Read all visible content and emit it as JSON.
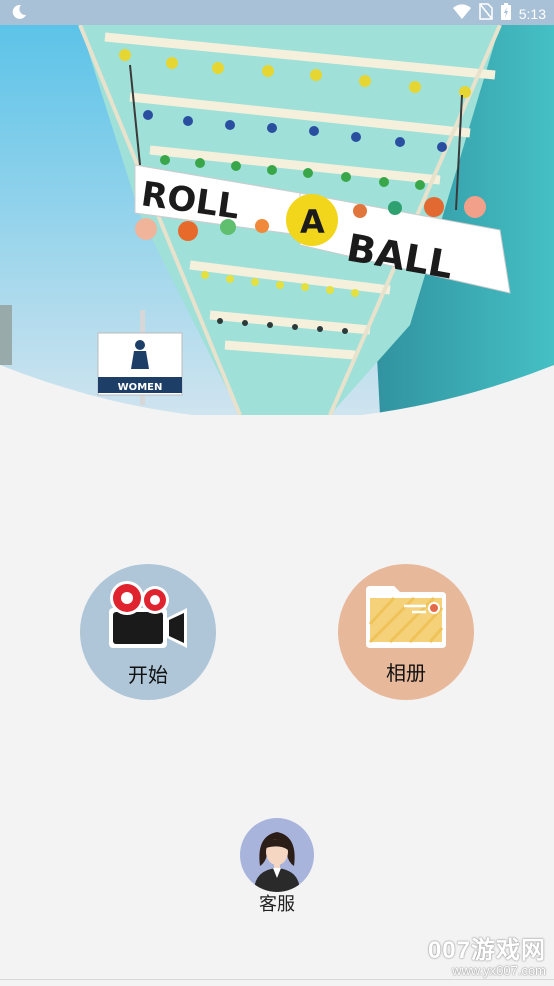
{
  "status_bar": {
    "time": "5:13",
    "icons": [
      "moon-icon",
      "wifi-icon",
      "no-sim-icon",
      "battery-icon"
    ]
  },
  "hero": {
    "sign_word_1": "ROLL",
    "sign_word_2": "A",
    "sign_word_3": "BALL",
    "restroom_sign": "WOMEN"
  },
  "actions": {
    "start_label": "开始",
    "album_label": "相册",
    "service_label": "客服"
  },
  "watermark": {
    "main": "007游戏网",
    "sub": "www.yx007.com"
  },
  "colors": {
    "status_bar": "#a9c1d6",
    "start_bg": "#aec6d8",
    "album_bg": "#e8b89b",
    "service_bg": "#a9b4dc",
    "background": "#f3f3f3"
  }
}
